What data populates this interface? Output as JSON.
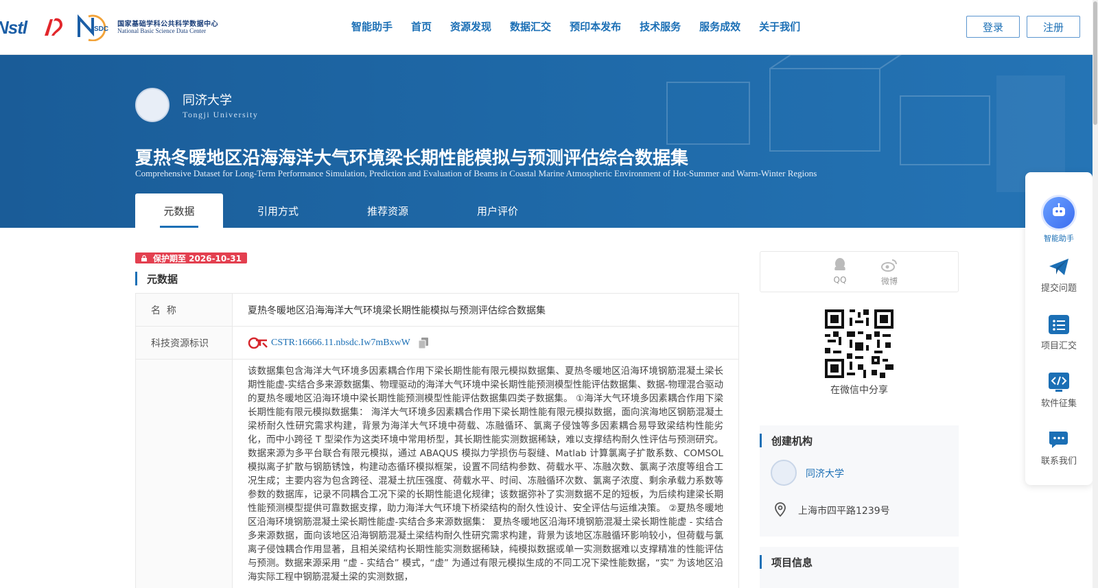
{
  "header": {
    "nstl_logo_text": "Nstl",
    "nsdc_cn": "国家基础学科公共科学数据中心",
    "nsdc_en": "National Basic Science Data Center",
    "nsdc_mark": "SDC",
    "nav": [
      "智能助手",
      "首页",
      "资源发现",
      "数据汇交",
      "预印本发布",
      "技术服务",
      "服务成效",
      "关于我们"
    ],
    "login": "登录",
    "register": "注册"
  },
  "banner": {
    "university": "同济大学",
    "university_en": "Tongji University",
    "title": "夏热冬暖地区沿海海洋大气环境梁长期性能模拟与预测评估综合数据集",
    "title_en": "Comprehensive Dataset for Long-Term Performance Simulation, Prediction and Evaluation of Beams in Coastal Marine Atmospheric Environment of Hot-Summer and Warm-Winter Regions",
    "tabs": [
      "元数据",
      "引用方式",
      "推荐资源",
      "用户评价"
    ]
  },
  "main": {
    "protect_badge": "保护期至 2026-10-31",
    "section_title": "元数据",
    "rows": {
      "name_key": "名  称",
      "name_val": "夏热冬暖地区沿海海洋大气环境梁长期性能模拟与预测评估综合数据集",
      "cstr_key": "科技资源标识",
      "cstr_val": "CSTR:16666.11.nbsdc.Iw7mBxwW",
      "desc_val": "该数据集包含海洋大气环境多因素耦合作用下梁长期性能有限元模拟数据集、夏热冬暖地区沿海环境钢筋混凝土梁长期性能虚-实结合多来源数据集、物理驱动的海洋大气环境中梁长期性能预测模型性能评估数据集、数据-物理混合驱动的夏热冬暖地区沿海环境中梁长期性能预测模型性能评估数据集四类子数据集。 ①海洋大气环境多因素耦合作用下梁长期性能有限元模拟数据集： 海洋大气环境多因素耦合作用下梁长期性能有限元模拟数据，面向滨海地区钢筋混凝土梁桥耐久性研究需求构建，背景为海洋大气环境中荷载、冻融循环、氯离子侵蚀等多因素耦合易导致梁结构性能劣化，而中小跨径 T 型梁作为这类环境中常用桥型，其长期性能实测数据稀缺，难以支撑结构耐久性评估与预测研究。数据来源为多平台联合有限元模拟，通过 ABAQUS 模拟力学损伤与裂缝、Matlab 计算氯离子扩散系数、COMSOL 模拟离子扩散与钢筋锈蚀，构建动态循环模拟框架，设置不同结构参数、荷载水平、冻融次数、氯离子浓度等组合工况生成；主要内容为包含跨径、混凝土抗压强度、荷载水平、时间、冻融循环次数、氯离子浓度、剩余承载力系数等参数的数据库，记录不同耦合工况下梁的长期性能退化规律；该数据弥补了实测数据不足的短板，为后续构建梁长期性能预测模型提供可靠数据支撑，助力海洋大气环境下桥梁结构的耐久性设计、安全评估与运维决策。 ②夏热冬暖地区沿海环境钢筋混凝土梁长期性能虚-实结合多来源数据集： 夏热冬暖地区沿海环境钢筋混凝土梁长期性能虚 - 实结合多来源数据，面向该地区沿海钢筋混凝土梁结构耐久性研究需求构建，背景为该地区冻融循环影响较小，但荷载与氯离子侵蚀耦合作用显著，且相关梁结构长期性能实测数据稀缺，纯模拟数据或单一实测数据难以支撑精准的性能评估与预测。数据来源采用 “虚 - 实结合” 模式，“虚” 为通过有限元模拟生成的不同工况下梁性能数据，“实” 为该地区沿海实际工程中钢筋混凝土梁的实测数据，"
    }
  },
  "sidebar": {
    "share_qq": "QQ",
    "share_weibo": "微博",
    "qr_caption": "在微信中分享",
    "org_title": "创建机构",
    "org_name": "同济大学",
    "org_address": "上海市四平路1239号",
    "project_title": "项目信息"
  },
  "float_panel": {
    "ai": "智能助手",
    "submit": "提交问题",
    "project": "项目汇交",
    "software": "软件征集",
    "contact": "联系我们"
  },
  "colors": {
    "brand_blue": "#1b6fb5",
    "banner_blue": "#1f6aa9",
    "protect_red": "#e33f4f"
  }
}
